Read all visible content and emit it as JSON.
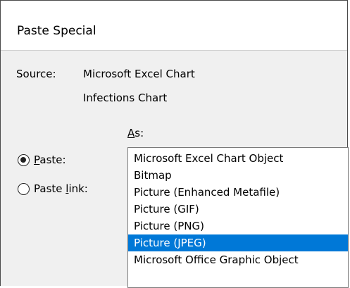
{
  "dialog": {
    "title": "Paste Special"
  },
  "source": {
    "label": "Source:",
    "value_line1": "Microsoft Excel Chart",
    "value_line2": "Infections Chart"
  },
  "as": {
    "label_prefix": "A",
    "label_suffix": "s:"
  },
  "options": {
    "paste": {
      "label_prefix": "",
      "accel": "P",
      "label_suffix": "aste:",
      "checked": true
    },
    "paste_link": {
      "label_prefix": "Paste ",
      "accel": "l",
      "label_suffix": "ink:",
      "checked": false
    }
  },
  "list": {
    "selected_index": 5,
    "items": [
      "Microsoft Excel Chart Object",
      "Bitmap",
      "Picture (Enhanced Metafile)",
      "Picture (GIF)",
      "Picture (PNG)",
      "Picture (JPEG)",
      "Microsoft Office Graphic Object"
    ]
  },
  "colors": {
    "selection": "#0078d7",
    "dialog_background": "#f0f0f0"
  }
}
